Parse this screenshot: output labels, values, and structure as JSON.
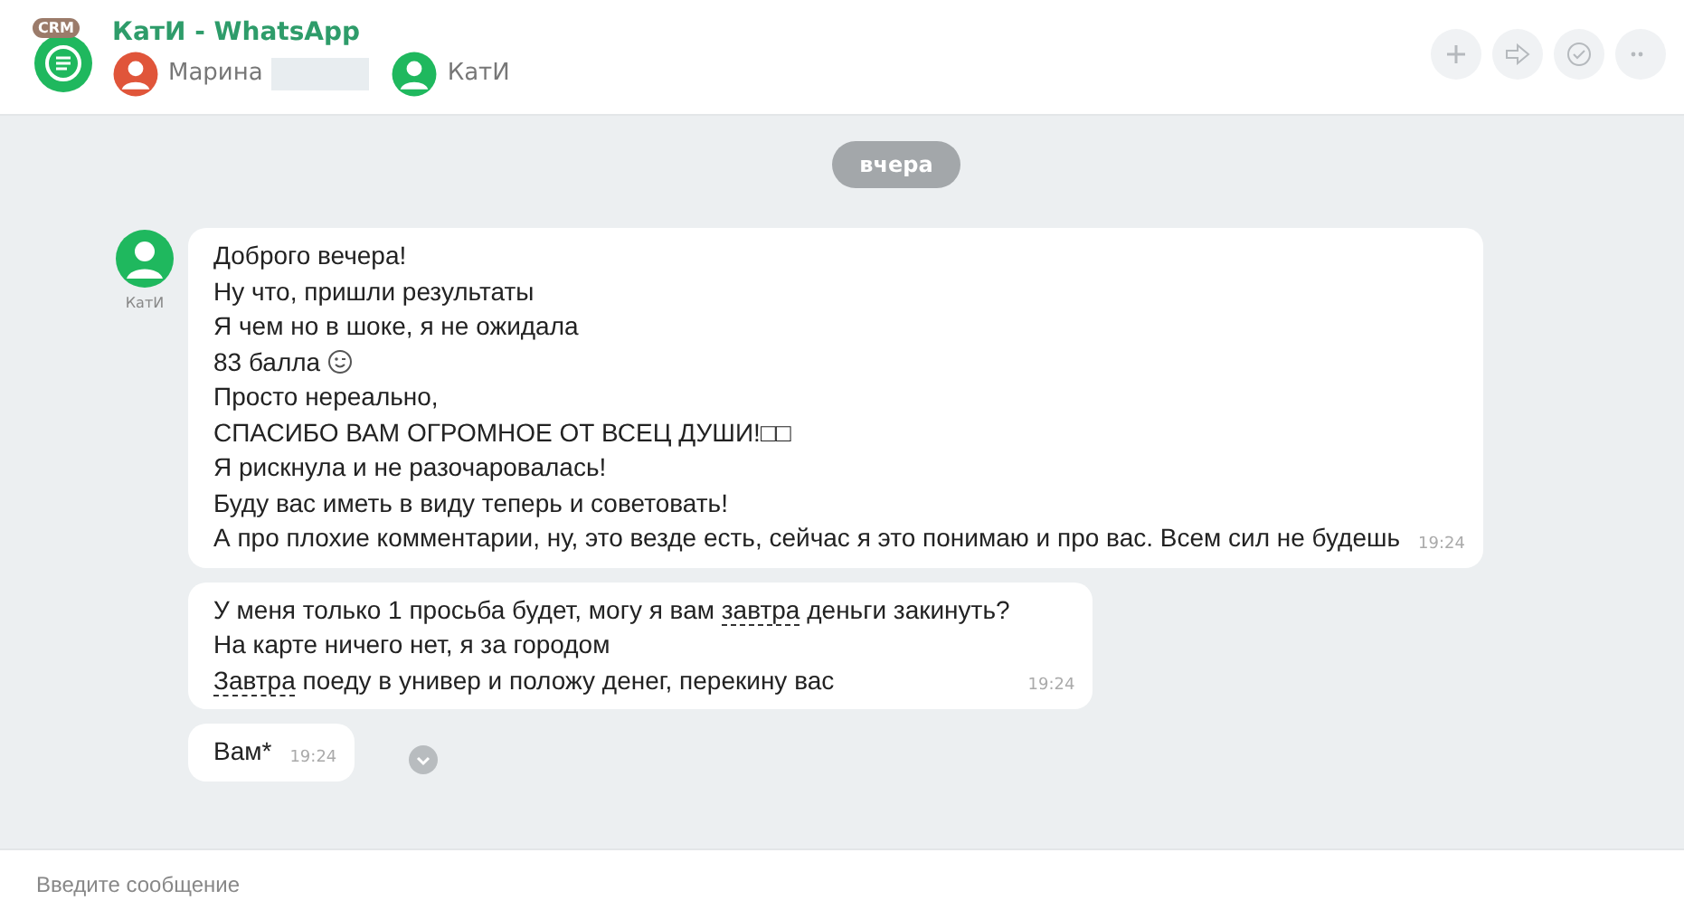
{
  "header": {
    "title": "КатИ - WhatsApp",
    "badge": "CRM",
    "participants": [
      {
        "name": "Марина",
        "kind": "client",
        "redacted": true
      },
      {
        "name": "КатИ",
        "kind": "operator",
        "redacted": false
      }
    ]
  },
  "date_divider": "вчера",
  "messages": [
    {
      "author": "КатИ",
      "time": "19:24",
      "menu": false,
      "lines": [
        [
          {
            "kind": "text",
            "text": "Доброго вечера!"
          }
        ],
        [
          {
            "kind": "text",
            "text": "Ну что, пришли результаты"
          }
        ],
        [
          {
            "kind": "text",
            "text": "Я чем но в шоке, я не ожидала"
          }
        ],
        [
          {
            "kind": "text",
            "text": "83 балла "
          },
          {
            "kind": "emoji"
          }
        ],
        [
          {
            "kind": "text",
            "text": "Просто нереально,"
          }
        ],
        [
          {
            "kind": "text",
            "text": "СПАСИБО ВАМ ОГРОМНОЕ ОТ ВСЕЦ ДУШИ!□□"
          }
        ],
        [
          {
            "kind": "text",
            "text": "Я рискнула и не разочаровалась!"
          }
        ],
        [
          {
            "kind": "text",
            "text": "Буду вас иметь в виду теперь и советовать!"
          }
        ],
        [
          {
            "kind": "text",
            "text": "А про плохие комментарии, ну, это везде есть, сейчас я это понимаю и про вас. Всем сил не будешь"
          }
        ]
      ]
    },
    {
      "time": "19:24",
      "menu": false,
      "lines": [
        [
          {
            "kind": "text",
            "text": "У меня только 1 просьба будет, могу я вам "
          },
          {
            "kind": "link",
            "text": "завтра"
          },
          {
            "kind": "text",
            "text": " деньги закинуть?"
          }
        ],
        [
          {
            "kind": "text",
            "text": "На карте ничего нет, я за городом"
          }
        ],
        [
          {
            "kind": "link",
            "text": "Завтра"
          },
          {
            "kind": "text",
            "text": " поеду в универ и положу денег, перекину вас"
          }
        ]
      ]
    },
    {
      "time": "19:24",
      "menu": true,
      "lines": [
        [
          {
            "kind": "text",
            "text": "Вам*"
          }
        ]
      ]
    }
  ],
  "composer": {
    "placeholder": "Введите сообщение"
  }
}
